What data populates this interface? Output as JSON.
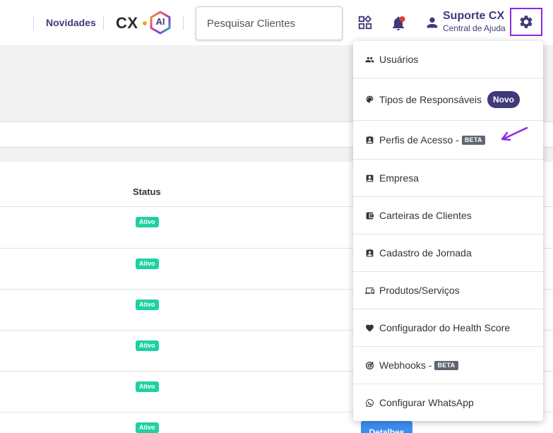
{
  "header": {
    "novidades": "Novidades",
    "logo_cx": "CX",
    "logo_ai": "AI",
    "search_placeholder": "Pesquisar Clientes",
    "user_name": "Suporte CX",
    "user_subtitle": "Central de Ajuda"
  },
  "table": {
    "status_header": "Status",
    "rows": [
      {
        "status": "Ativo"
      },
      {
        "status": "Ativo"
      },
      {
        "status": "Ativo"
      },
      {
        "status": "Ativo"
      },
      {
        "status": "Ativo"
      },
      {
        "status": "Ativo"
      }
    ],
    "details_label": "Detalhes"
  },
  "menu": {
    "items": [
      {
        "label": "Usuários",
        "icon": "users-icon"
      },
      {
        "label": "Tipos de Responsáveis",
        "icon": "palette-icon",
        "badge": "Novo"
      },
      {
        "label": "Perfis de Acesso - ",
        "icon": "badge-icon",
        "badge": "BETA"
      },
      {
        "label": "Empresa",
        "icon": "contact-icon"
      },
      {
        "label": "Carteiras de Clientes",
        "icon": "wallet-icon"
      },
      {
        "label": "Cadastro de Jornada",
        "icon": "clipboard-icon"
      },
      {
        "label": "Produtos/Serviços",
        "icon": "devices-icon"
      },
      {
        "label": "Configurador do Health Score",
        "icon": "heart-icon"
      },
      {
        "label": "Webhooks - ",
        "icon": "webhook-icon",
        "badge": "BETA"
      },
      {
        "label": "Configurar WhatsApp",
        "icon": "whatsapp-icon"
      }
    ]
  },
  "colors": {
    "brand_primary": "#3f3a7a",
    "highlight": "#8a2be2",
    "status_active": "#1fd1a0",
    "beta_badge": "#5f6571",
    "details_button": "#3d8ef0",
    "notification_dot": "#e53935"
  }
}
